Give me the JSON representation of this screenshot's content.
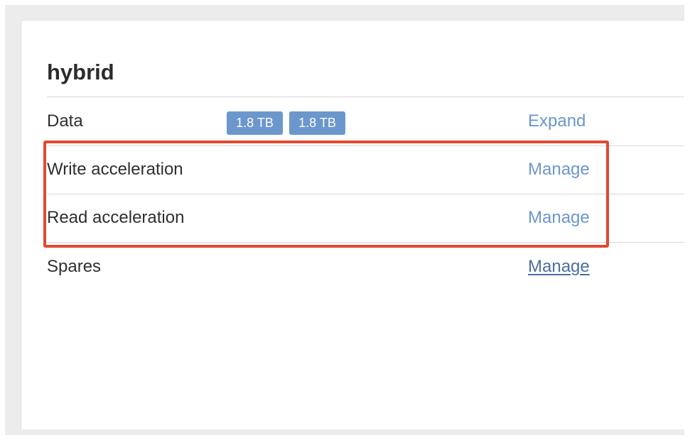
{
  "pool": {
    "title": "hybrid"
  },
  "rows": {
    "data": {
      "label": "Data",
      "badges": [
        "1.8 TB",
        "1.8 TB"
      ],
      "action": "Expand"
    },
    "write": {
      "label": "Write acceleration",
      "action": "Manage"
    },
    "read": {
      "label": "Read acceleration",
      "action": "Manage"
    },
    "spares": {
      "label": "Spares",
      "action": "Manage"
    }
  },
  "colors": {
    "link": "#6b97cc",
    "badge_bg": "#6b97cc",
    "highlight": "#e04a2f"
  }
}
